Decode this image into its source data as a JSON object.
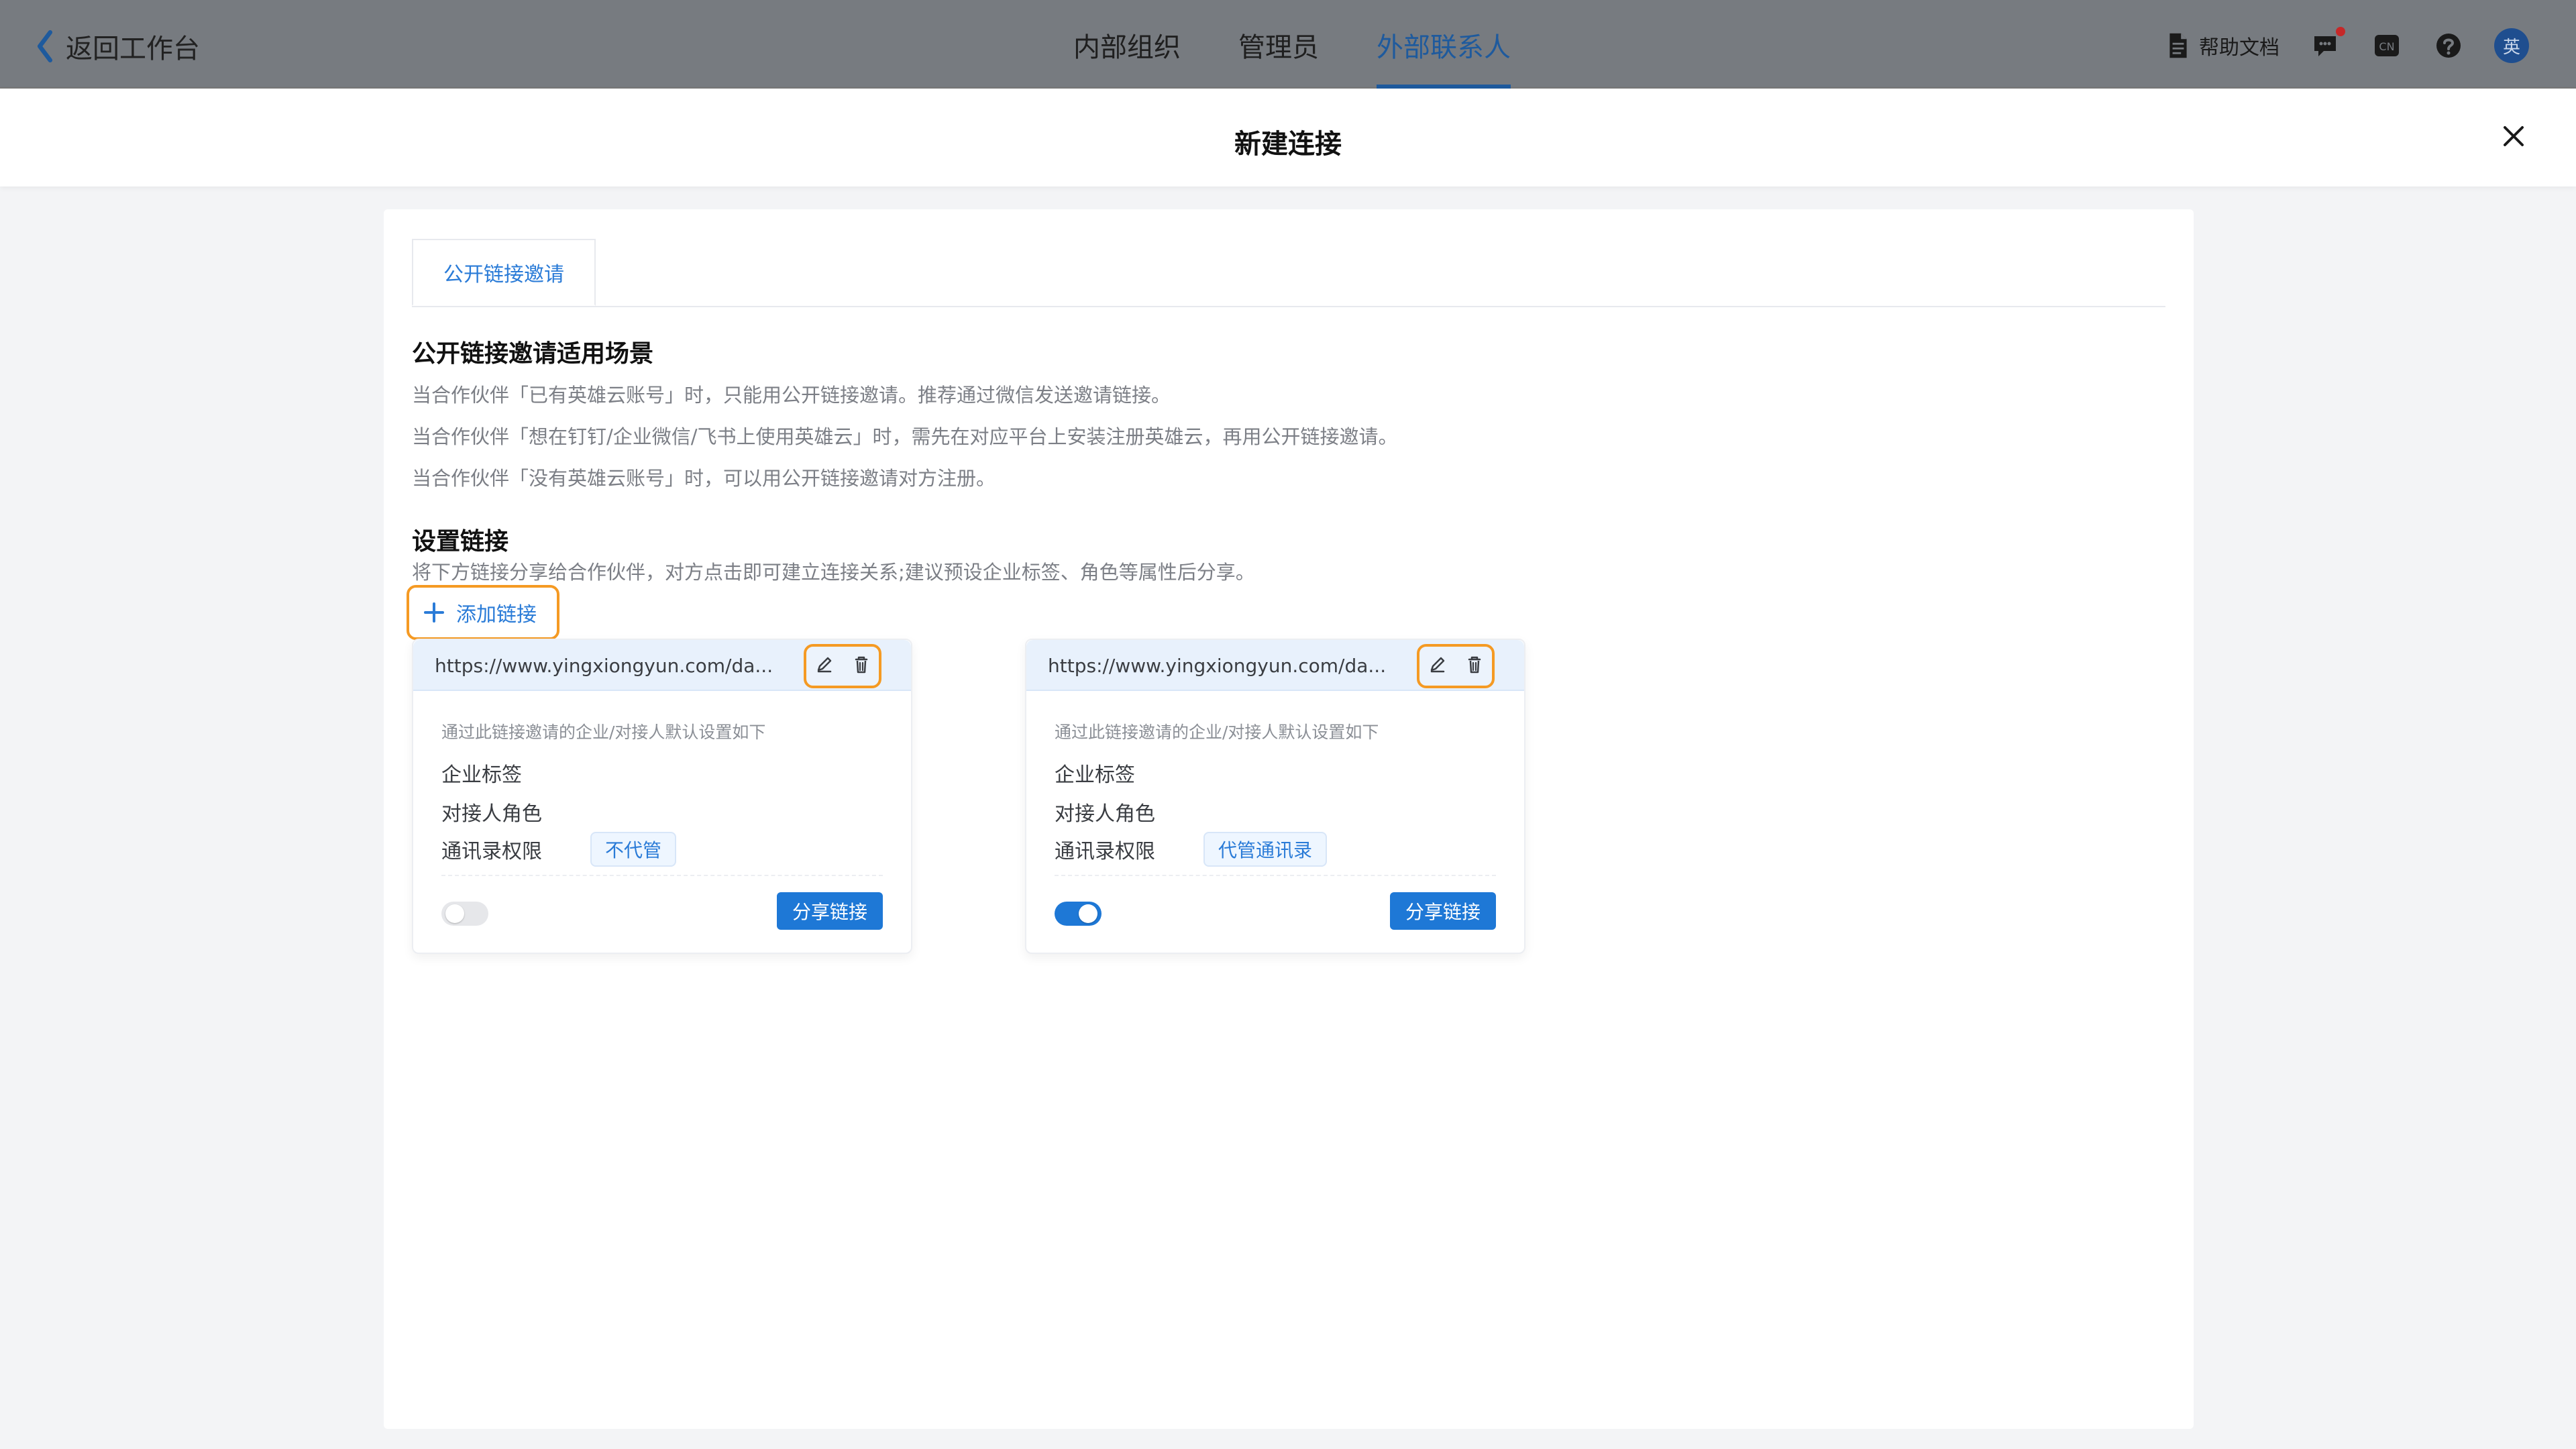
{
  "colors": {
    "accent": "#1e78d6",
    "accent_text": "#2a7bd7",
    "highlight_orange": "#f59a23",
    "overlay_bg": "#777b80",
    "panel_bg": "#ffffff",
    "page_bg": "#f3f4f6"
  },
  "topbar": {
    "back_label": "返回工作台",
    "tabs": [
      {
        "label": "内部组织"
      },
      {
        "label": "管理员"
      },
      {
        "label": "外部联系人",
        "active": true
      }
    ],
    "tools": {
      "help_docs_label": "帮助文档",
      "lang_badge": "CN",
      "help_icon": "question-circle-icon",
      "messages_icon": "message-icon",
      "avatar_text": "英"
    }
  },
  "modal": {
    "title": "新建连接",
    "close_icon": "close-icon"
  },
  "content": {
    "tab_label": "公开链接邀请",
    "scenario": {
      "title": "公开链接邀请适用场景",
      "lines": [
        "当合作伙伴「已有英雄云账号」时，只能用公开链接邀请。推荐通过微信发送邀请链接。",
        "当合作伙伴「想在钉钉/企业微信/飞书上使用英雄云」时，需先在对应平台上安装注册英雄云，再用公开链接邀请。",
        "当合作伙伴「没有英雄云账号」时，可以用公开链接邀请对方注册。"
      ]
    },
    "setup": {
      "title": "设置链接",
      "hint": "将下方链接分享给合作伙伴，对方点击即可建立连接关系;建议预设企业标签、角色等属性后分享。",
      "add_link_label": "添加链接"
    },
    "cards": [
      {
        "url": "https://www.yingxiongyun.com/da...",
        "note": "通过此链接邀请的企业/对接人默认设置如下",
        "enterprise_tag_label": "企业标签",
        "contact_role_label": "对接人角色",
        "contacts_perm_label": "通讯录权限",
        "contacts_perm_value": "不代管",
        "toggle_on": false,
        "share_label": "分享链接"
      },
      {
        "url": "https://www.yingxiongyun.com/da...",
        "note": "通过此链接邀请的企业/对接人默认设置如下",
        "enterprise_tag_label": "企业标签",
        "contact_role_label": "对接人角色",
        "contacts_perm_label": "通讯录权限",
        "contacts_perm_value": "代管通讯录",
        "toggle_on": true,
        "share_label": "分享链接"
      }
    ]
  }
}
